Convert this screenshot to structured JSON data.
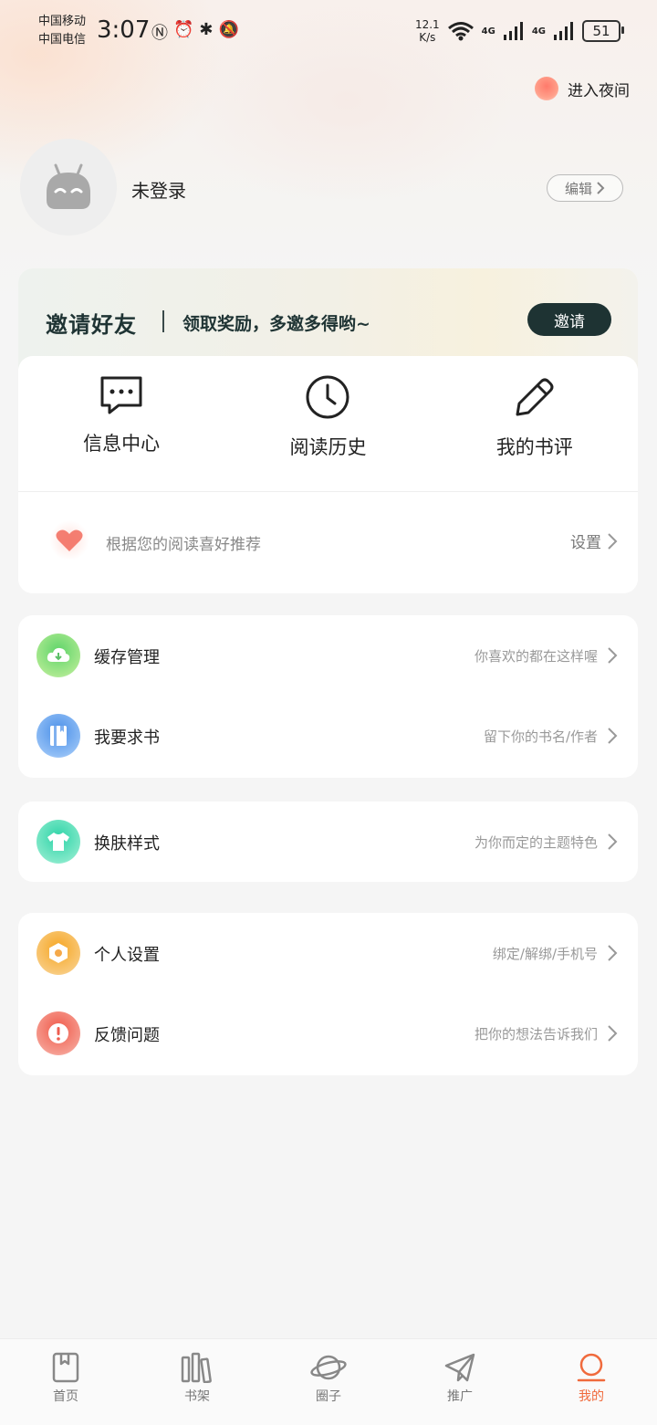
{
  "status_bar": {
    "carrier1": "中国移动",
    "carrier2": "中国电信",
    "time": "3:07",
    "net_speed_value": "12.1",
    "net_speed_unit": "K/s",
    "signal1": "4G",
    "signal2": "4G",
    "battery": "51"
  },
  "header": {
    "night_mode_label": "进入夜间",
    "username": "未登录",
    "edit_label": "编辑"
  },
  "invite": {
    "title": "邀请好友",
    "subtitle": "领取奖励，多邀多得哟~",
    "button": "邀请"
  },
  "quick_actions": [
    {
      "label": "信息中心",
      "icon": "message-icon"
    },
    {
      "label": "阅读历史",
      "icon": "clock-icon"
    },
    {
      "label": "我的书评",
      "icon": "pen-icon"
    }
  ],
  "recommend": {
    "text": "根据您的阅读喜好推荐",
    "setting": "设置"
  },
  "menu": {
    "cache": {
      "title": "缓存管理",
      "hint": "你喜欢的都在这样喔"
    },
    "request": {
      "title": "我要求书",
      "hint": "留下你的书名/作者"
    },
    "skin": {
      "title": "换肤样式",
      "hint": "为你而定的主题特色"
    },
    "personal": {
      "title": "个人设置",
      "hint": "绑定/解绑/手机号"
    },
    "feedback": {
      "title": "反馈问题",
      "hint": "把你的想法告诉我们"
    }
  },
  "nav": [
    {
      "label": "首页",
      "icon": "book-icon"
    },
    {
      "label": "书架",
      "icon": "bookshelf-icon"
    },
    {
      "label": "圈子",
      "icon": "planet-icon"
    },
    {
      "label": "推广",
      "icon": "paper-plane-icon"
    },
    {
      "label": "我的",
      "icon": "person-icon"
    }
  ],
  "colors": {
    "accent": "#f06a3c",
    "invite_button": "#1e3333"
  }
}
